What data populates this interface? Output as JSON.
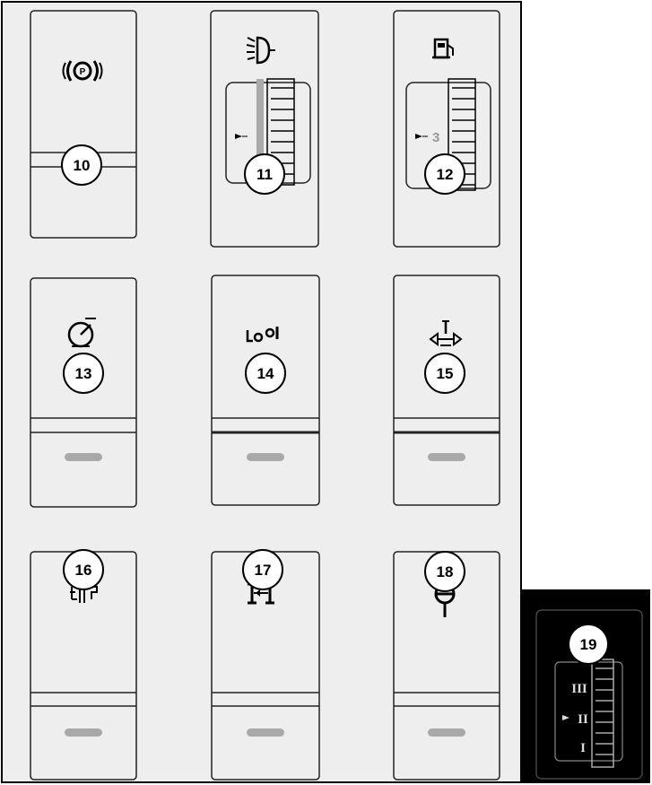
{
  "diagram": {
    "callouts": [
      "10",
      "11",
      "12",
      "13",
      "14",
      "15",
      "16",
      "17",
      "18",
      "19"
    ],
    "stepper_12_value": "3",
    "inset_19_positions": [
      "III",
      "II",
      "I"
    ]
  },
  "icons": {
    "10": "parking-brake-icon",
    "11": "headlight-icon",
    "12": "fuel-pump-icon",
    "13": "speedometer-icon",
    "14": "differential-lock-icon",
    "15": "hitch-icon",
    "16": "pto-shaft-icon",
    "17": "axle-icon",
    "18": "pin-icon"
  }
}
